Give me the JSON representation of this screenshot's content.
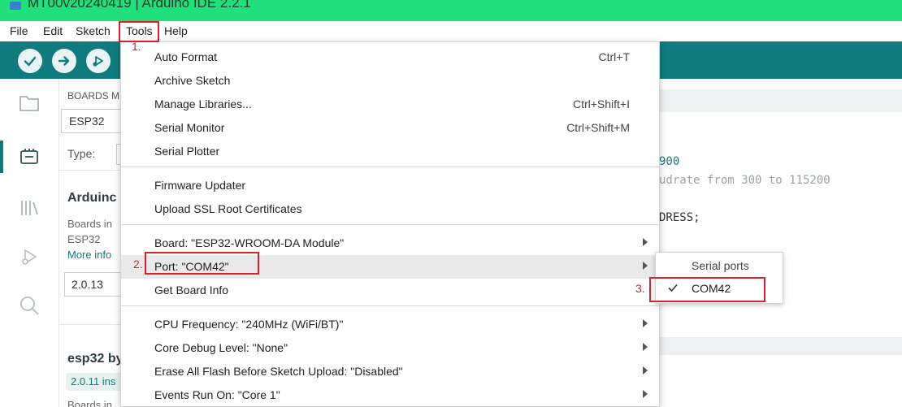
{
  "window": {
    "title": "MT00v20240419 | Arduino IDE 2.2.1"
  },
  "menubar": [
    "File",
    "Edit",
    "Sketch",
    "Tools",
    "Help"
  ],
  "toolbar": {
    "icons": [
      "verify-icon",
      "upload-icon",
      "debug-icon"
    ]
  },
  "sidebar": {
    "icons": [
      "folder-icon",
      "boards-manager-icon",
      "library-icon",
      "debug-icon",
      "search-icon"
    ]
  },
  "boards_manager": {
    "header": "BOARDS M",
    "search_value": "ESP32",
    "type_label": "Type:",
    "item1": {
      "title": "Arduinc",
      "line1": "Boards in",
      "line2": "ESP32",
      "more": "More info",
      "version": "2.0.13"
    },
    "item2": {
      "title": "esp32 by",
      "installed": "2.0.11 ins",
      "line1": "Boards in"
    }
  },
  "editor": {
    "lines": [
      "900",
      "udrate from 300 to 115200",
      "DRESS;"
    ]
  },
  "tools_menu": {
    "items": [
      {
        "label": "Auto Format",
        "shortcut": "Ctrl+T"
      },
      {
        "label": "Archive Sketch",
        "shortcut": ""
      },
      {
        "label": "Manage Libraries...",
        "shortcut": "Ctrl+Shift+I"
      },
      {
        "label": "Serial Monitor",
        "shortcut": "Ctrl+Shift+M"
      },
      {
        "label": "Serial Plotter",
        "shortcut": ""
      },
      {
        "label": "Firmware Updater",
        "shortcut": ""
      },
      {
        "label": "Upload SSL Root Certificates",
        "shortcut": ""
      },
      {
        "label": "Board: \"ESP32-WROOM-DA Module\"",
        "shortcut": ""
      },
      {
        "label": "Port: \"COM42\"",
        "shortcut": ""
      },
      {
        "label": "Get Board Info",
        "shortcut": ""
      },
      {
        "label": "CPU Frequency: \"240MHz (WiFi/BT)\"",
        "shortcut": ""
      },
      {
        "label": "Core Debug Level: \"None\"",
        "shortcut": ""
      },
      {
        "label": "Erase All Flash Before Sketch Upload: \"Disabled\"",
        "shortcut": ""
      },
      {
        "label": "Events Run On: \"Core 1\"",
        "shortcut": ""
      }
    ]
  },
  "port_submenu": {
    "header": "Serial ports",
    "selected": "COM42"
  },
  "annotations": {
    "step1": "1.",
    "step2": "2.",
    "step3": "3."
  },
  "colors": {
    "titlebar": "#1fe07a",
    "toolbar": "#0f7b7e",
    "callout": "#d9232b"
  }
}
